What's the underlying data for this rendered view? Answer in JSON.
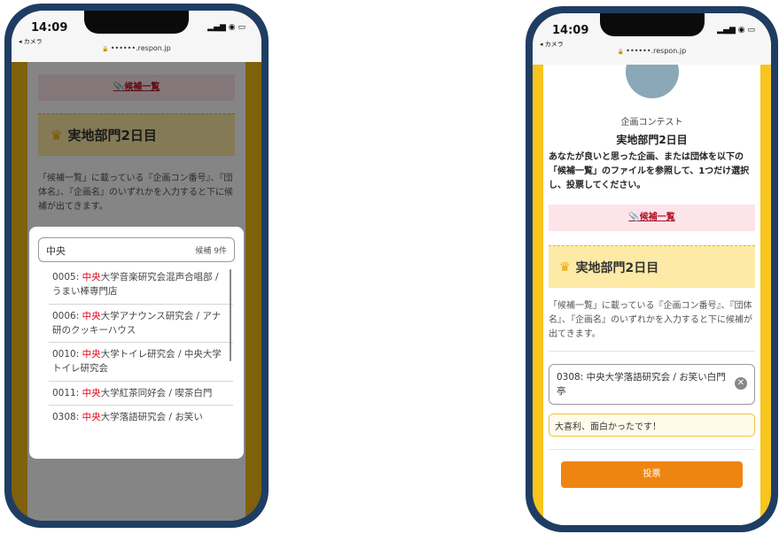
{
  "statusbar": {
    "time": "14:09",
    "back_app": "◂ カメラ",
    "url": "••••••.respon.jp",
    "icons": "▂▄▆ ◉ ▭"
  },
  "left": {
    "link_text": "候補一覧",
    "section_title": "実地部門2日目",
    "description": "「候補一覧」に載っている『企画コン番号』、『団体名』、『企画名』のいずれかを入力すると下に候補が出てきます。",
    "search_query": "中央",
    "candidate_count": "候補 9件",
    "results": [
      {
        "pre": "0005: ",
        "hl": "中央",
        "post": "大学音楽研究会混声合唱部 / うまい棒専門店"
      },
      {
        "pre": "0006: ",
        "hl": "中央",
        "post": "大学アナウンス研究会 / アナ研のクッキーハウス"
      },
      {
        "pre": "0010: ",
        "hl": "中央",
        "post": "大学トイレ研究会 / 中央大学トイレ研究会"
      },
      {
        "pre": "0011: ",
        "hl": "中央",
        "post": "大学紅茶同好会 / 喫茶白門"
      },
      {
        "pre": "0308: ",
        "hl": "中央",
        "post": "大学落語研究会 / お笑い"
      }
    ]
  },
  "right": {
    "contest_name": "企画コンテスト",
    "page_title": "実地部門2日目",
    "instructions": "あなたが良いと思った企画、または団体を以下の「候補一覧」のファイルを参照して、1つだけ選択し、投票してください。",
    "link_text": "候補一覧",
    "section_title": "実地部門2日目",
    "description": "「候補一覧」に載っている『企画コン番号』、『団体名』、『企画名』のいずれかを入力すると下に候補が出てきます。",
    "selected_value": "0308: 中央大学落語研究会 / お笑い白門亭",
    "comment": "大喜利、面白かったです！",
    "vote_label": "投票"
  }
}
